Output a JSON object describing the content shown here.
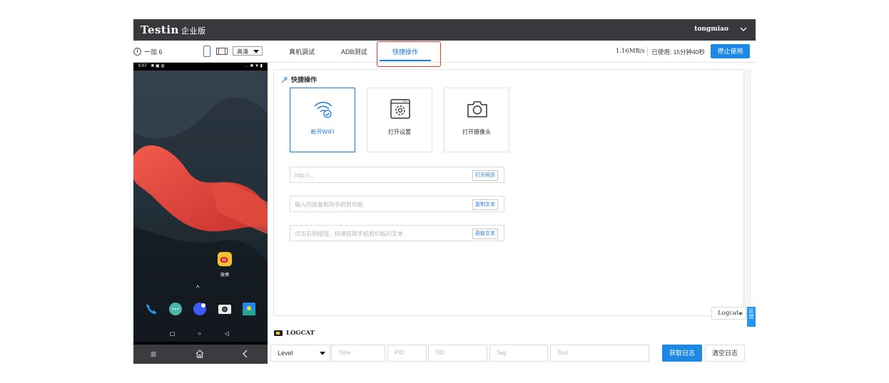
{
  "header": {
    "brand": "Testin",
    "edition": "企业版",
    "username": "tongmiao"
  },
  "toolbar": {
    "device_name": "一加 6",
    "quality": "高清",
    "tabs": [
      {
        "label": "真机调试"
      },
      {
        "label": "ADB测试"
      },
      {
        "label": "快捷操作"
      }
    ],
    "network_speed": "1.16MB/s",
    "used_time": "已使用: 15分钟40秒",
    "stop_label": "停止使用"
  },
  "phone": {
    "status_time": "5:07",
    "app_label": "微博"
  },
  "quick_actions": {
    "title": "快捷操作",
    "cards": [
      {
        "label": "断开WIFI",
        "icon": "wifi-icon"
      },
      {
        "label": "打开设置",
        "icon": "settings-icon"
      },
      {
        "label": "打开摄像头",
        "icon": "camera-icon"
      }
    ],
    "url_field": {
      "placeholder": "http://...",
      "button": "打开网页"
    },
    "copy_field": {
      "placeholder": "输入内容复制到手机剪切板",
      "button": "复制文本"
    },
    "get_field": {
      "placeholder": "点击右侧按钮，快速获取手机剪切板的文本",
      "button": "获取文本"
    }
  },
  "logcat": {
    "select": "Logcat",
    "feedback": "反馈",
    "title": "LOGCAT",
    "filters": {
      "level": "Level",
      "time": "Time",
      "pid": "PID",
      "tid": "TID",
      "tag": "Tag",
      "text": "Text"
    },
    "get_label": "获取日志",
    "clear_label": "清空日志"
  }
}
